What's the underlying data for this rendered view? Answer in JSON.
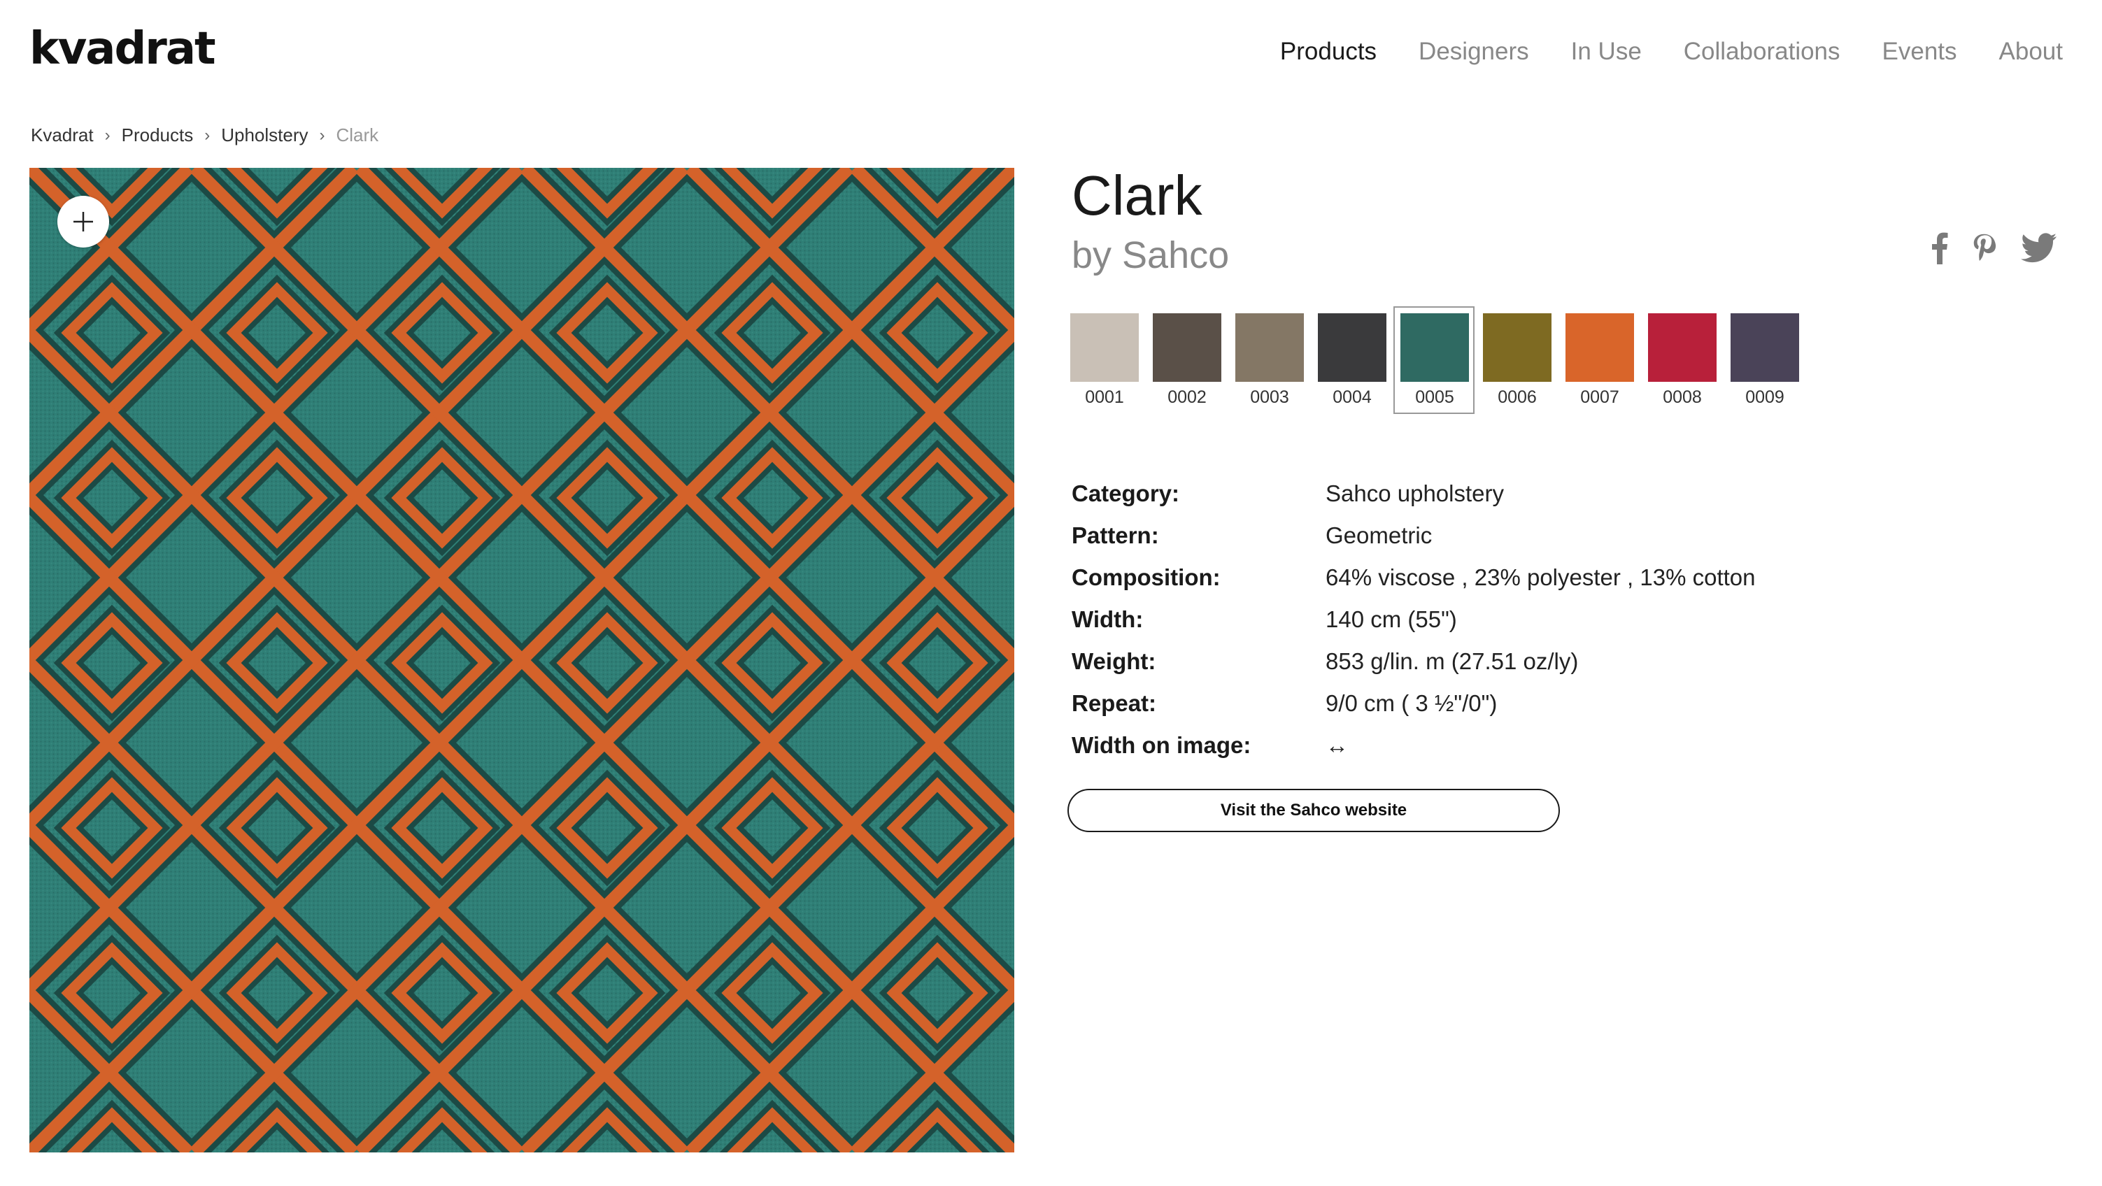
{
  "header": {
    "logo": "kvadrat",
    "nav": [
      "Products",
      "Designers",
      "In Use",
      "Collaborations",
      "Events",
      "About"
    ],
    "active_nav": "Products"
  },
  "breadcrumb": [
    "Kvadrat",
    "Products",
    "Upholstery",
    "Clark"
  ],
  "product": {
    "name": "Clark",
    "by": "by Sahco",
    "selected_colour": "0005",
    "colours": [
      {
        "code": "0001",
        "color": "#c9c0b6"
      },
      {
        "code": "0002",
        "color": "#5a5048"
      },
      {
        "code": "0003",
        "color": "#847765"
      },
      {
        "code": "0004",
        "color": "#3a3a3c"
      },
      {
        "code": "0005",
        "color": "#2f6a62"
      },
      {
        "code": "0006",
        "color": "#7e6a22"
      },
      {
        "code": "0007",
        "color": "#d9652a"
      },
      {
        "code": "0008",
        "color": "#b8203a"
      },
      {
        "code": "0009",
        "color": "#4a4358"
      }
    ],
    "specs": [
      {
        "label": "Category:",
        "value": "Sahco upholstery"
      },
      {
        "label": "Pattern:",
        "value": "Geometric"
      },
      {
        "label": "Composition:",
        "value": "64% viscose , 23% polyester , 13% cotton"
      },
      {
        "label": "Width:",
        "value": "140 cm (55\")"
      },
      {
        "label": "Weight:",
        "value": "853 g/lin. m (27.51 oz/ly)"
      },
      {
        "label": "Repeat:",
        "value": "9/0 cm ( 3 ½\"/0\")"
      },
      {
        "label": "Width on image:",
        "value": "↔"
      }
    ],
    "visit_button": "Visit the Sahco website"
  },
  "share_icons": [
    "facebook-icon",
    "pinterest-icon",
    "twitter-icon"
  ],
  "fabric_colors": {
    "base": "#2f7f76",
    "line": "#d4622a",
    "shadow": "#1c4a45"
  }
}
